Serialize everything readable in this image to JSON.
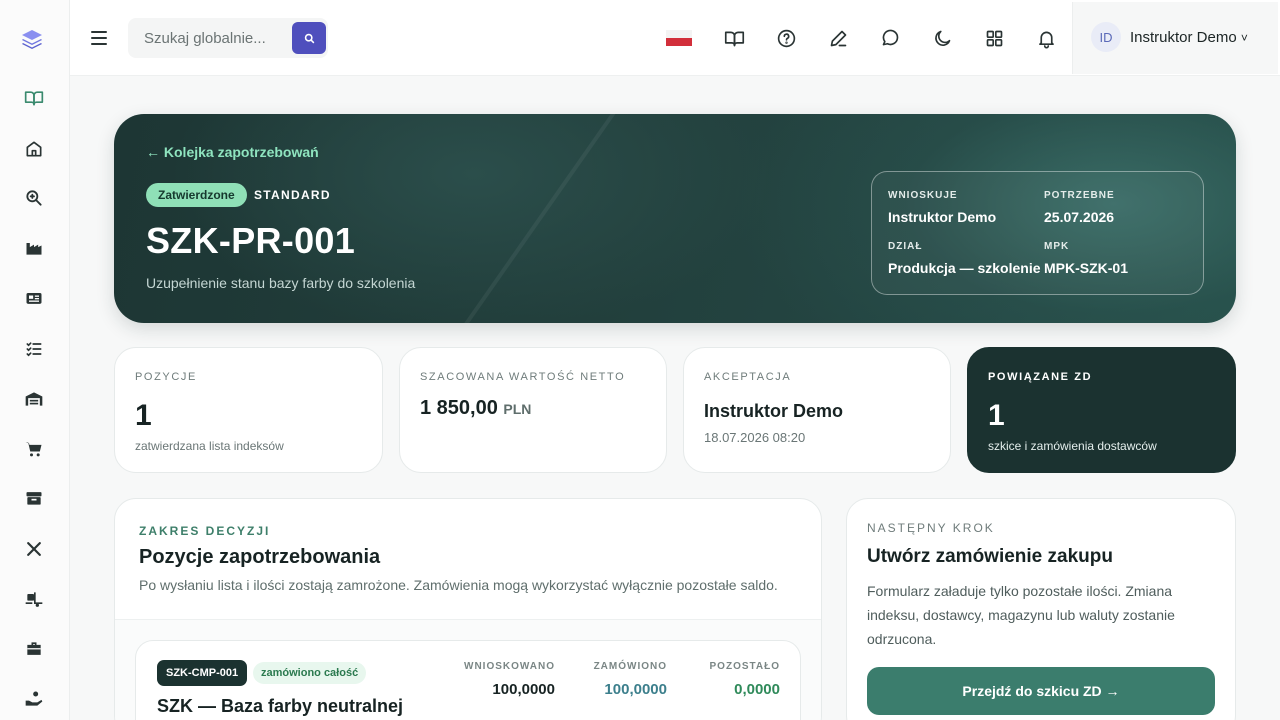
{
  "topbar": {
    "search_placeholder": "Szukaj globalnie...",
    "user_initials": "ID",
    "user_name": "Instruktor Demo",
    "user_caret": "˅"
  },
  "hero": {
    "back_link": "← Kolejka zapotrzebowań",
    "status": "Zatwierdzone",
    "type": "STANDARD",
    "title": "SZK-PR-001",
    "subtitle": "Uzupełnienie stanu bazy farby do szkolenia",
    "meta": {
      "requester_label": "WNIOSKUJE",
      "requester": "Instruktor Demo",
      "needed_label": "POTRZEBNE",
      "needed": "25.07.2026",
      "department_label": "DZIAŁ",
      "department": "Produkcja — szkolenie",
      "cost_center_label": "MPK",
      "cost_center": "MPK-SZK-01"
    }
  },
  "stats": {
    "positions": {
      "label": "POZYCJE",
      "value": "1",
      "note": "zatwierdzana lista indeksów"
    },
    "net_value": {
      "label": "SZACOWANA WARTOŚĆ NETTO",
      "value": "1 850,00",
      "currency": "PLN"
    },
    "approval": {
      "label": "AKCEPTACJA",
      "name": "Instruktor Demo",
      "date": "18.07.2026 08:20"
    },
    "linked_orders": {
      "label": "POWIĄZANE ZD",
      "value": "1",
      "note": "szkice i zamówienia dostawców"
    }
  },
  "decision": {
    "kicker": "ZAKRES DECYZJI",
    "title": "Pozycje zapotrzebowania",
    "description": "Po wysłaniu lista i ilości zostają zamrożone. Zamówienia mogą wykorzystać wyłącznie pozostałe saldo.",
    "item": {
      "code": "SZK-CMP-001",
      "status": "zamówiono całość",
      "name": "SZK — Baza farby neutralnej",
      "requested_label": "WNIOSKOWANO",
      "requested": "100,0000",
      "ordered_label": "ZAMÓWIONO",
      "ordered": "100,0000",
      "remaining_label": "POZOSTAŁO",
      "remaining": "0,0000"
    }
  },
  "next_step": {
    "kicker": "NASTĘPNY KROK",
    "title": "Utwórz zamówienie zakupu",
    "description": "Formularz załaduje tylko pozostałe ilości. Zmiana indeksu, dostawcy, magazynu lub waluty zostanie odrzucona.",
    "button": "Przejdź do szkicu ZD →"
  },
  "colors": {
    "accent": "#4f4fbd",
    "hero_dark": "#1d3634",
    "success": "#8fe0b7",
    "primary_button": "#3b7d6d"
  },
  "icons": {
    "sidebar": [
      "logo-layers-icon",
      "book-open-icon",
      "home-icon",
      "search-zoom-icon",
      "factory-icon",
      "id-card-icon",
      "list-check-icon",
      "warehouse-icon",
      "cart-icon",
      "box-icon",
      "tools-icon",
      "truck-loading-icon",
      "briefcase-icon",
      "hand-coin-icon"
    ],
    "topbar": [
      "menu-icon",
      "search-icon",
      "flag-pl-icon",
      "book-icon",
      "help-icon",
      "pen-icon",
      "chat-icon",
      "moon-icon",
      "grid-icon",
      "bell-icon"
    ]
  }
}
